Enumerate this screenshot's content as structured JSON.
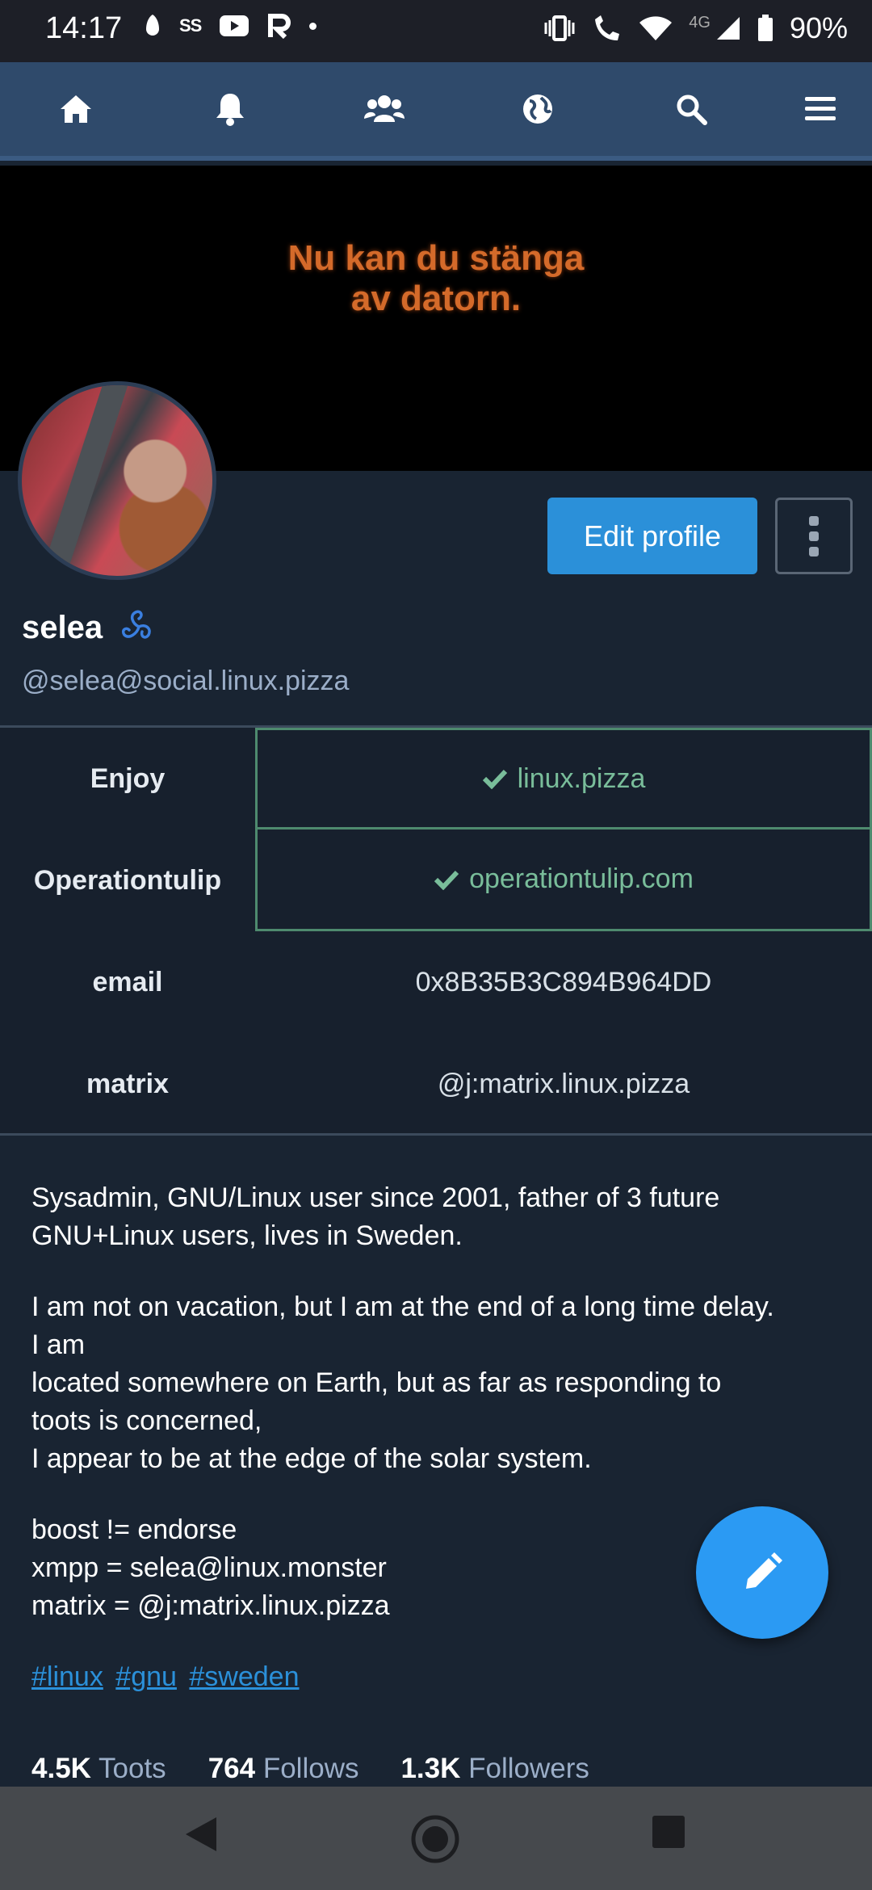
{
  "status_bar": {
    "time": "14:17",
    "notif_text": "SS",
    "battery": "90%",
    "network": "4G"
  },
  "nav": {
    "items": [
      "home-icon",
      "bell-icon",
      "users-icon",
      "globe-icon",
      "search-icon",
      "menu-icon"
    ]
  },
  "header": {
    "caption_line1": "Nu kan du stänga",
    "caption_line2": "av datorn."
  },
  "profile": {
    "display_name": "selea",
    "handle": "@selea@social.linux.pizza",
    "edit_label": "Edit profile"
  },
  "fields": [
    {
      "key": "Enjoy",
      "value": "linux.pizza",
      "verified": true
    },
    {
      "key": "Operationtulip",
      "value": "operationtulip.com",
      "verified": true
    },
    {
      "key": "email",
      "value": "0x8B35B3C894B964DD",
      "verified": false
    },
    {
      "key": "matrix",
      "value": "@j:matrix.linux.pizza",
      "verified": false
    }
  ],
  "bio": {
    "p1_l1": "Sysadmin, GNU/Linux user since 2001, father of 3 future",
    "p1_l2": "GNU+Linux users, lives in Sweden.",
    "p2_l1": "I am not on vacation, but I am at the end of a long time delay.",
    "p2_l2": "I am",
    "p2_l3": "located somewhere on Earth, but as far as responding to",
    "p2_l4": "toots is concerned,",
    "p2_l5": "I appear to be at the edge of the solar system.",
    "p3_l1": "boost != endorse",
    "p3_l2": "xmpp = selea@linux.monster",
    "p3_l3": "matrix = @j:matrix.linux.pizza",
    "tags": [
      "#linux",
      "#gnu",
      "#sweden"
    ]
  },
  "stats": {
    "toots_count": "4.5K",
    "toots_label": "Toots",
    "follows_count": "764",
    "follows_label": "Follows",
    "followers_count": "1.3K",
    "followers_label": "Followers"
  },
  "colors": {
    "accent": "#2b90d9",
    "verified": "#79bd9a",
    "background": "#192432",
    "navbar": "#2f4a6b"
  }
}
